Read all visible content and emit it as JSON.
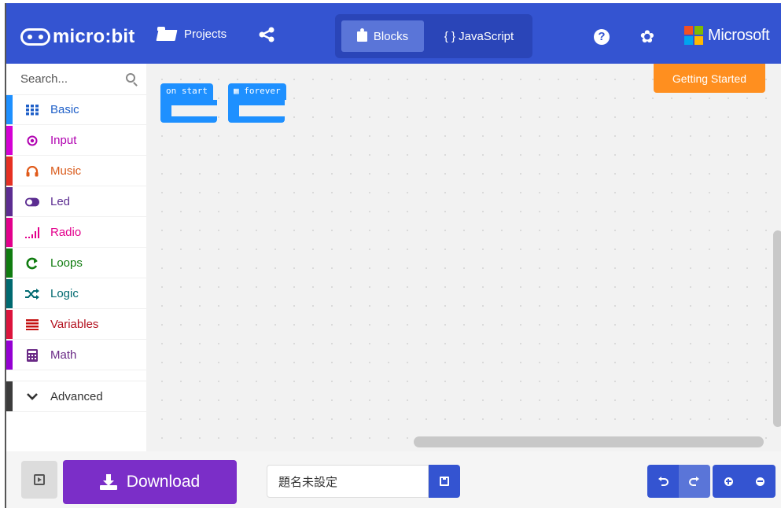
{
  "header": {
    "logo_text": "micro:bit",
    "projects_label": "Projects",
    "share_icon": "share-icon",
    "tabs": [
      {
        "label": "Blocks",
        "selected": true
      },
      {
        "label": "{ } JavaScript",
        "selected": false
      }
    ],
    "help_icon": "help-icon",
    "settings_icon": "gear-icon",
    "brand": "Microsoft",
    "colors": {
      "header": "#3454d1",
      "toggle_bg": "#2a45b8",
      "selected_tab": "#5a75d8"
    }
  },
  "sidebar": {
    "search_placeholder": "Search...",
    "categories": [
      {
        "label": "Basic",
        "icon": "grid-icon",
        "color": "#1e90ff"
      },
      {
        "label": "Input",
        "icon": "target-icon",
        "color": "#d400d4"
      },
      {
        "label": "Music",
        "icon": "headphones-icon",
        "color": "#e63022"
      },
      {
        "label": "Led",
        "icon": "toggle-icon",
        "color": "#5c2d91"
      },
      {
        "label": "Radio",
        "icon": "signal-icon",
        "color": "#e3008c"
      },
      {
        "label": "Loops",
        "icon": "loop-icon",
        "color": "#107c10"
      },
      {
        "label": "Logic",
        "icon": "shuffle-icon",
        "color": "#006970"
      },
      {
        "label": "Variables",
        "icon": "list-icon",
        "color": "#dc143c"
      },
      {
        "label": "Math",
        "icon": "calculator-icon",
        "color": "#9400d3"
      }
    ],
    "advanced": {
      "label": "Advanced",
      "icon": "chevron-down-icon",
      "color": "#3c3c3c"
    }
  },
  "workspace": {
    "getting_started": "Getting Started",
    "blocks": [
      {
        "label": "on start"
      },
      {
        "label": "forever"
      }
    ]
  },
  "bottom": {
    "download_label": "Download",
    "project_name": "題名未設定",
    "undo_icon": "undo-icon",
    "redo_icon": "redo-icon",
    "zoom_in_icon": "zoom-in-icon",
    "zoom_out_icon": "zoom-out-icon",
    "download_color": "#7b2ec8"
  }
}
